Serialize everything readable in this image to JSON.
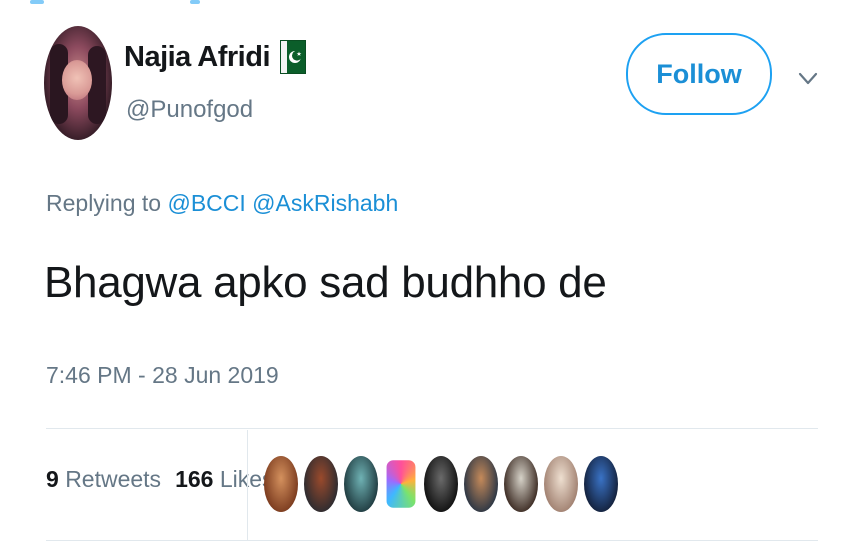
{
  "author": {
    "display_name": "Najia Afridi",
    "handle": "@Punofgod",
    "flag_icon": "pakistan-flag-icon"
  },
  "follow_label": "Follow",
  "reply": {
    "prefix": "Replying to",
    "mentions": [
      "@BCCI",
      "@AskRishabh"
    ]
  },
  "tweet_text": "Bhagwa apko sad budhho de",
  "timestamp": "7:46 PM - 28 Jun 2019",
  "stats": {
    "retweets_count": "9",
    "retweets_label": "Retweets",
    "likes_count": "166",
    "likes_label": "Likes"
  },
  "likers": [
    {
      "name": "liker-avatar-1",
      "colors": [
        "#7a3a1e",
        "#d4915e"
      ]
    },
    {
      "name": "liker-avatar-2",
      "colors": [
        "#2b2b30",
        "#9a4a2c"
      ]
    },
    {
      "name": "liker-avatar-3",
      "colors": [
        "#1f3a3f",
        "#6fb2b4"
      ]
    },
    {
      "name": "liker-avatar-4",
      "colors": [
        "#ff4f9a",
        "#3fb8ff"
      ]
    },
    {
      "name": "liker-avatar-5",
      "colors": [
        "#101010",
        "#6b6b6b"
      ]
    },
    {
      "name": "liker-avatar-6",
      "colors": [
        "#2a3544",
        "#c58a5a"
      ]
    },
    {
      "name": "liker-avatar-7",
      "colors": [
        "#3b2a22",
        "#d6d2c8"
      ]
    },
    {
      "name": "liker-avatar-8",
      "colors": [
        "#a08070",
        "#eedfd0"
      ]
    },
    {
      "name": "liker-avatar-9",
      "colors": [
        "#13203a",
        "#3a73c6"
      ]
    }
  ],
  "colors": {
    "accent": "#1da1f2",
    "text": "#14171a",
    "secondary": "#657786",
    "divider": "#e1e8ed"
  }
}
